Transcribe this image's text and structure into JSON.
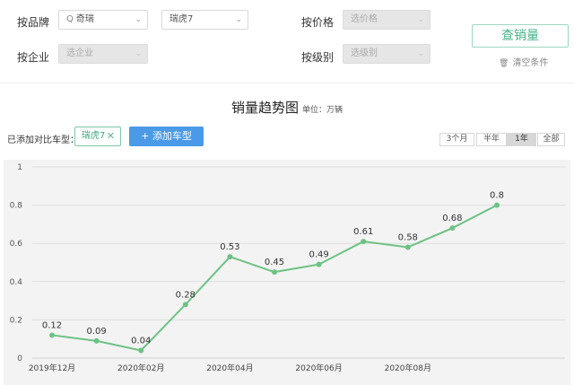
{
  "filters": {
    "brand_label": "按品牌",
    "brand_value": "奇瑞",
    "model_value": "瑞虎7",
    "company_label": "按企业",
    "company_placeholder": "选企业",
    "price_label": "按价格",
    "price_placeholder": "选价格",
    "level_label": "按级别",
    "level_placeholder": "选级别"
  },
  "actions": {
    "query_label": "查销量",
    "clear_label": "清空条件"
  },
  "chart_header": {
    "title": "销量趋势图",
    "unit": "单位：万辆"
  },
  "compare": {
    "added_label": "已添加对比车型：",
    "tag_label": "瑞虎7",
    "add_button_label": "+ 添加车型"
  },
  "ranges": {
    "options": [
      "3个月",
      "半年",
      "1年",
      "全部"
    ],
    "selected": "1年"
  },
  "colors": {
    "accent": "#47b38a",
    "series": "#6cc283",
    "add_button": "#4b9ae7"
  },
  "chart_data": {
    "type": "line",
    "title": "销量趋势图",
    "unit": "万辆",
    "x": [
      "2019-12",
      "2020-01",
      "2020-02",
      "2020-03",
      "2020-04",
      "2020-05",
      "2020-06",
      "2020-07",
      "2020-08",
      "2020-09",
      "2020-10"
    ],
    "x_tick_labels": [
      "2019年12月",
      "2020年02月",
      "2020年04月",
      "2020年06月",
      "2020年08月"
    ],
    "series": [
      {
        "values": [
          0.12,
          0.09,
          0.04,
          0.28,
          0.53,
          0.45,
          0.49,
          0.61,
          0.58,
          0.68,
          0.8
        ]
      }
    ],
    "y_ticks": [
      "0",
      "0.2",
      "0.4",
      "0.6",
      "0.8",
      "1"
    ],
    "ylim": [
      0,
      1
    ],
    "grid": true,
    "data_labels": [
      "0.12",
      "0.09",
      "0.04",
      "0.28",
      "0.53",
      "0.45",
      "0.49",
      "0.61",
      "0.58",
      "0.68",
      "0.8"
    ]
  }
}
